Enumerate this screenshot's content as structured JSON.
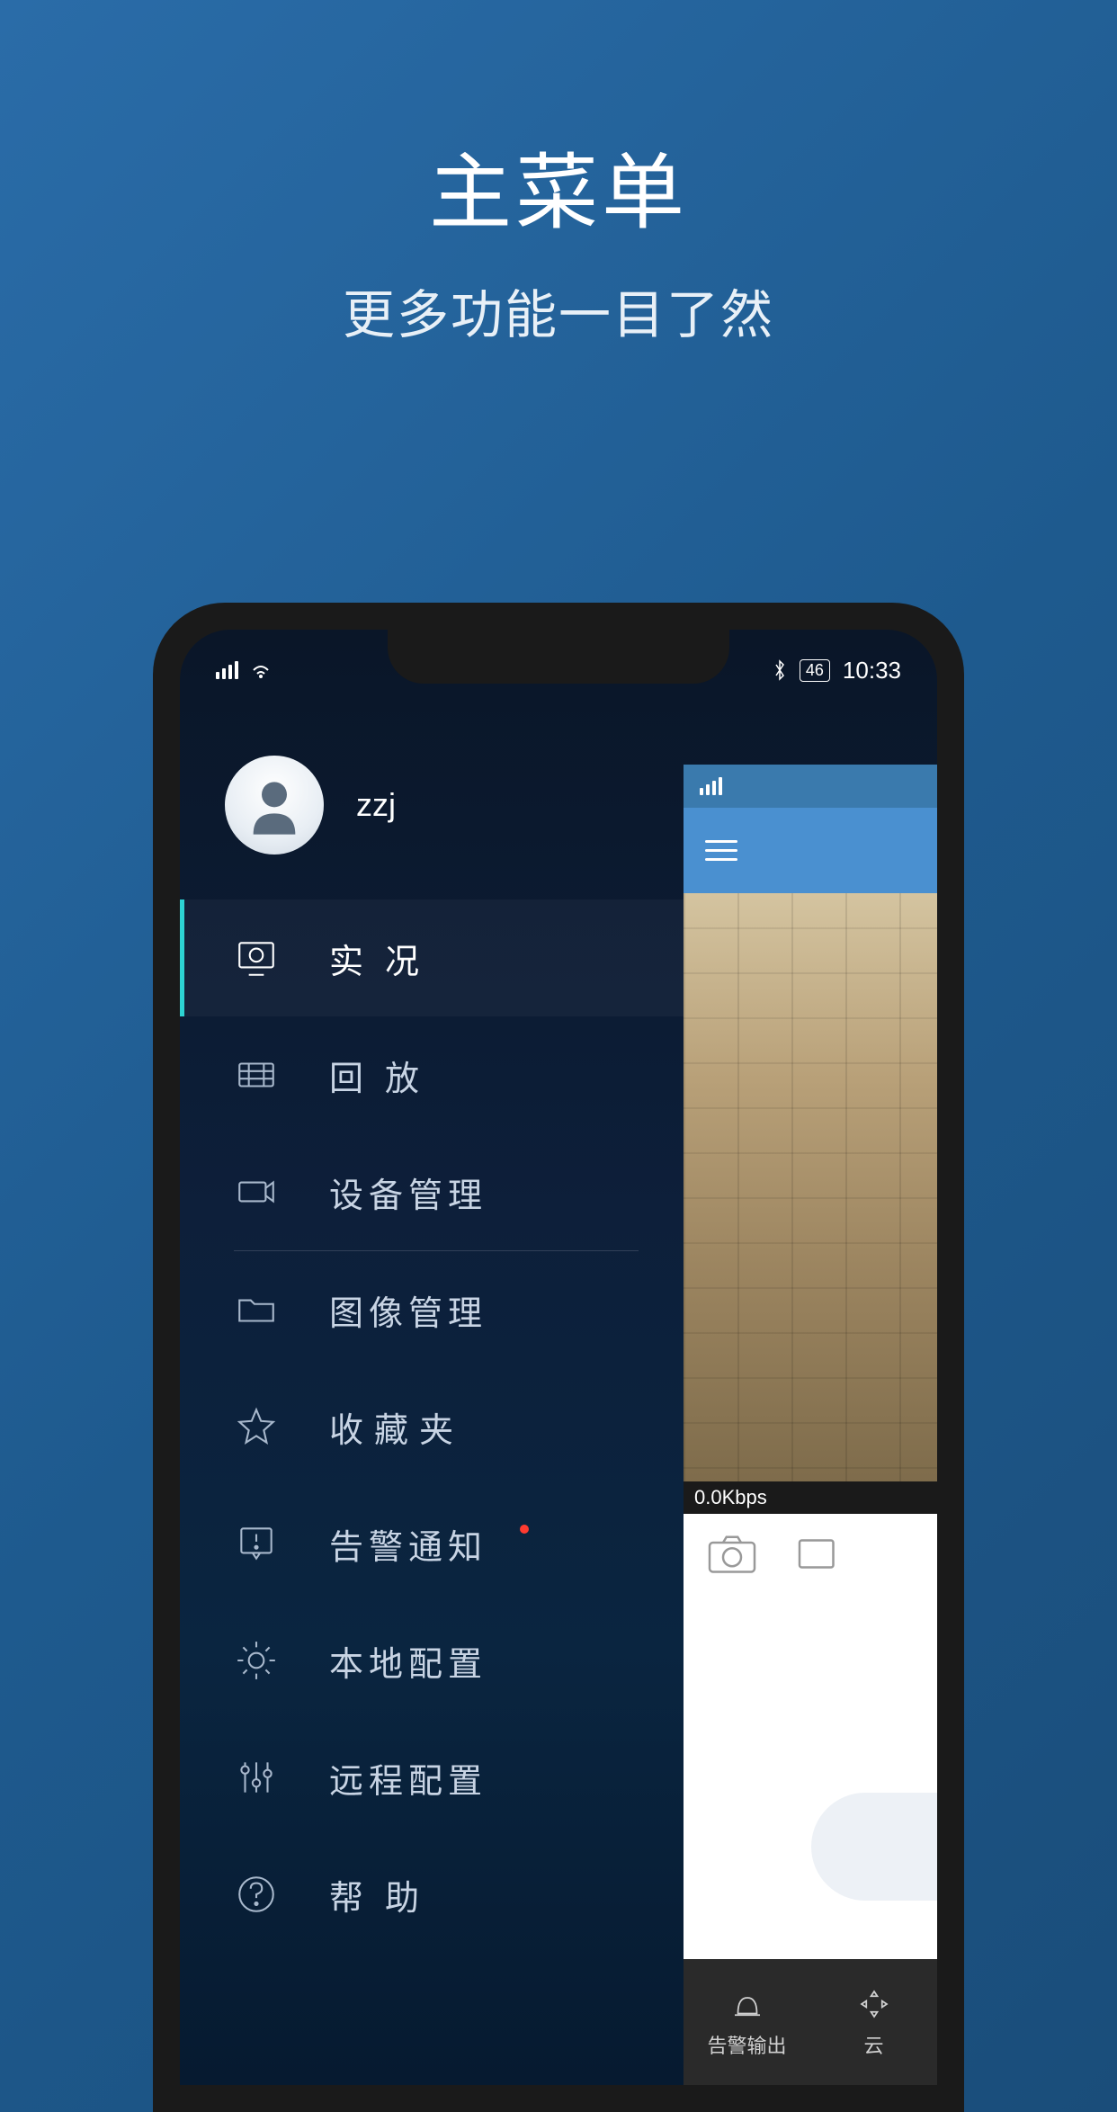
{
  "promo": {
    "title": "主菜单",
    "subtitle": "更多功能一目了然"
  },
  "status_bar": {
    "time": "10:33",
    "battery_label": "46"
  },
  "profile": {
    "username": "zzj"
  },
  "menu": {
    "items": [
      {
        "label": "实况",
        "icon": "monitor",
        "spaced": true,
        "active": true
      },
      {
        "label": "回放",
        "icon": "film",
        "spaced": true
      },
      {
        "label": "设备管理",
        "icon": "camera",
        "spaced": false,
        "divider_after": true
      },
      {
        "label": "图像管理",
        "icon": "folder",
        "spaced": false
      },
      {
        "label": "收藏夹",
        "icon": "star",
        "spaced": true
      },
      {
        "label": "告警通知",
        "icon": "alert",
        "spaced": false,
        "badge": true
      },
      {
        "label": "本地配置",
        "icon": "gear",
        "spaced": false
      },
      {
        "label": "远程配置",
        "icon": "sliders",
        "spaced": false
      },
      {
        "label": "帮助",
        "icon": "help",
        "spaced": true
      }
    ]
  },
  "content_peek": {
    "bitrate": "0.0Kbps",
    "bottom_buttons": [
      {
        "label": "告警输出",
        "icon": "alarm"
      },
      {
        "label": "云",
        "icon": "ptz"
      }
    ]
  }
}
